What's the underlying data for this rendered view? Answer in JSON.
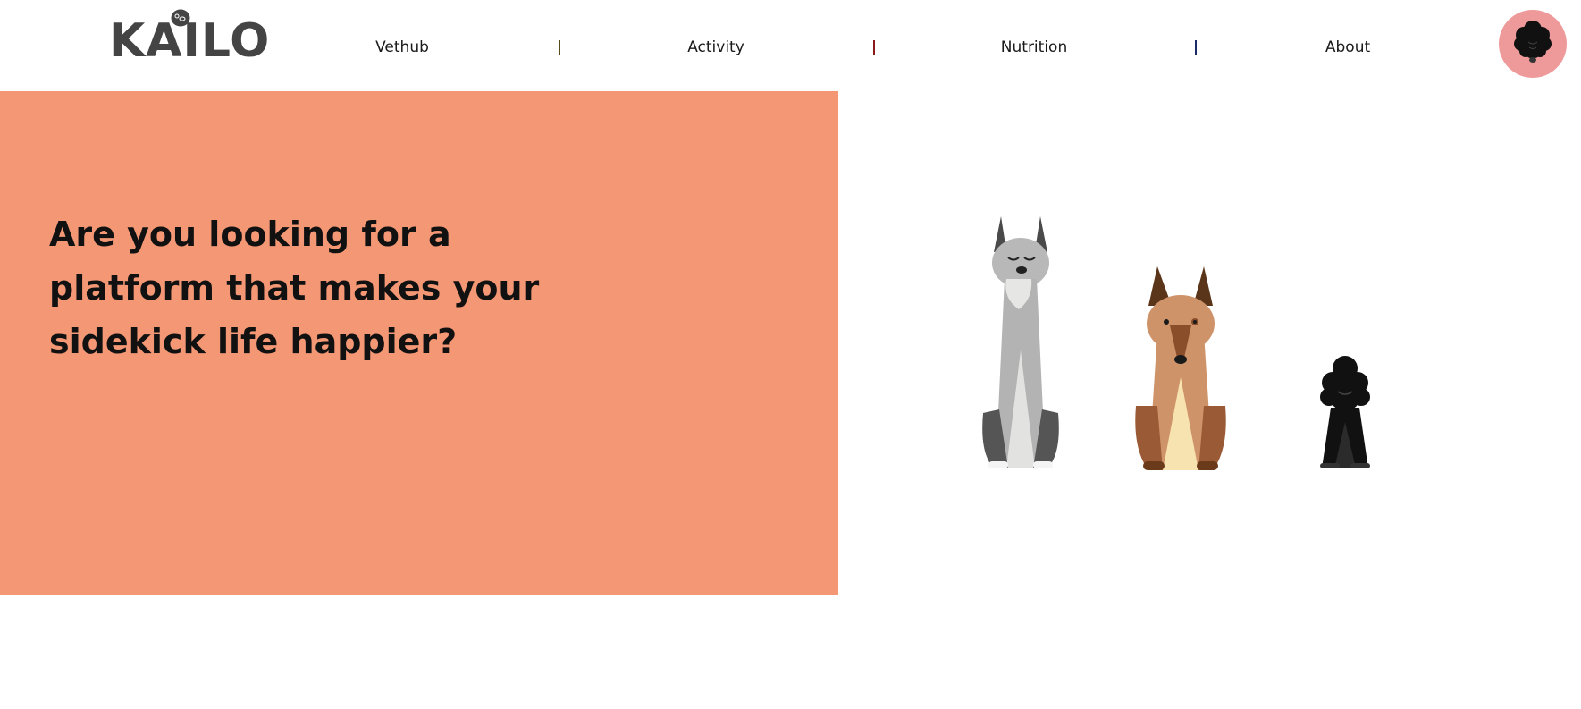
{
  "brand": {
    "logo_text": "KAILO"
  },
  "nav": {
    "items": [
      {
        "label": "Vethub"
      },
      {
        "label": "Activity"
      },
      {
        "label": "Nutrition"
      },
      {
        "label": "About"
      }
    ],
    "separator": "|"
  },
  "hero": {
    "headline": "Are you looking for a platform that makes your sidekick life happier?"
  },
  "colors": {
    "hero_background": "#f39774",
    "avatar_background": "#ef9a9a",
    "logo": "#444444",
    "nav_separator": "#8b1a1a"
  },
  "illustration": {
    "dogs": [
      "great-dane-icon",
      "german-shepherd-icon",
      "poodle-icon"
    ]
  }
}
